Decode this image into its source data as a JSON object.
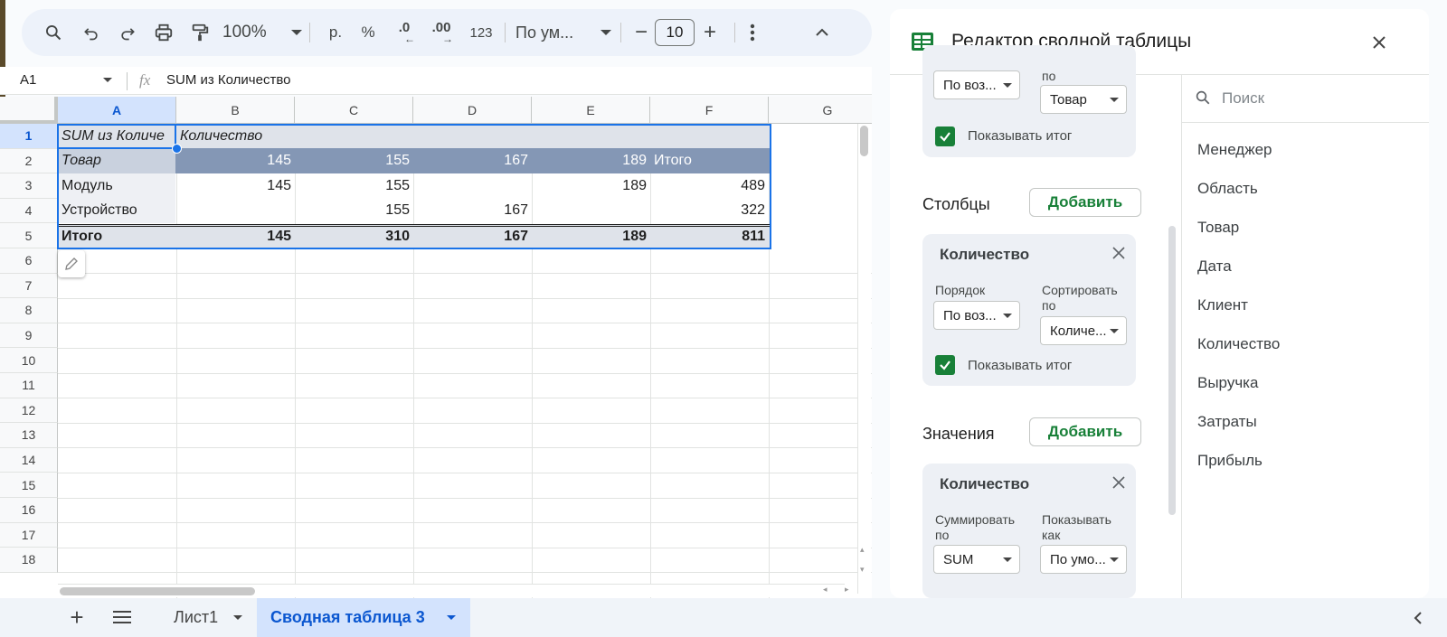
{
  "toolbar": {
    "zoom": "100%",
    "currency": "р.",
    "percent": "%",
    "dec_decrease": ".0",
    "dec_increase": ".00",
    "number_format": "123",
    "font_name": "По ум...",
    "font_size": "10"
  },
  "formula_bar": {
    "cell_ref": "A1",
    "fx": "fx",
    "formula": "SUM из Количество"
  },
  "columns": [
    "A",
    "B",
    "C",
    "D",
    "E",
    "F",
    "G"
  ],
  "rows": [
    "1",
    "2",
    "3",
    "4",
    "5",
    "6",
    "7",
    "8",
    "9",
    "10",
    "11",
    "12",
    "13",
    "14",
    "15",
    "16",
    "17",
    "18"
  ],
  "pivot": {
    "r1a": "SUM из Количе",
    "r1b": "Количество",
    "r2": [
      "Товар",
      "145",
      "155",
      "167",
      "189",
      "Итого"
    ],
    "r3": [
      "Модуль",
      "145",
      "155",
      "",
      "189",
      "489"
    ],
    "r4": [
      "Устройство",
      "",
      "155",
      "167",
      "",
      "322"
    ],
    "r5": [
      "Итого",
      "145",
      "310",
      "167",
      "189",
      "811"
    ]
  },
  "sheets": {
    "sheet1": "Лист1",
    "sheet2": "Сводная таблица 3"
  },
  "panel": {
    "title": "Редактор сводной таблицы",
    "rows_card": {
      "order_value": "По воз...",
      "sortby_label": "по",
      "sortby_value": "Товар",
      "show_total": "Показывать итог"
    },
    "columns_section": {
      "label": "Столбцы",
      "add": "Добавить",
      "card_title": "Количество",
      "order_label": "Порядок",
      "order_value": "По воз...",
      "sort_label": "Сортировать по",
      "sort_value": "Количе...",
      "show_total": "Показывать итог"
    },
    "values_section": {
      "label": "Значения",
      "add": "Добавить",
      "card_title": "Количество",
      "summarize_label": "Суммировать по",
      "summarize_value": "SUM",
      "show_as_label": "Показывать как",
      "show_as_value": "По умо..."
    },
    "search_placeholder": "Поиск",
    "fields": [
      "Менеджер",
      "Область",
      "Товар",
      "Дата",
      "Клиент",
      "Количество",
      "Выручка",
      "Затраты",
      "Прибыль"
    ]
  },
  "colors": {
    "accent_green": "#188038",
    "selection_blue": "#1a73e8",
    "pivot_header": "#8497b5",
    "pivot_light": "#dfe3ea"
  }
}
